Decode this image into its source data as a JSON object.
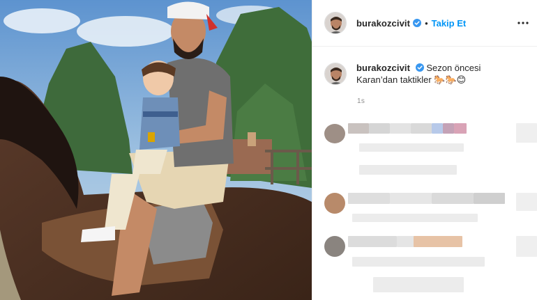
{
  "post": {
    "username": "burakozcivit",
    "follow_label": "Takip Et",
    "separator": "•",
    "caption_text": "Sezon öncesi Karan’dan taktikler",
    "caption_emojis": "🐎🐎😊",
    "timestamp": "1s"
  },
  "icons": {
    "verified": "verified-badge-icon",
    "more": "more-options-icon"
  },
  "colors": {
    "link_blue": "#0095f6",
    "verified_blue": "#3897f0",
    "text": "#262626",
    "muted": "#8e8e8e"
  }
}
